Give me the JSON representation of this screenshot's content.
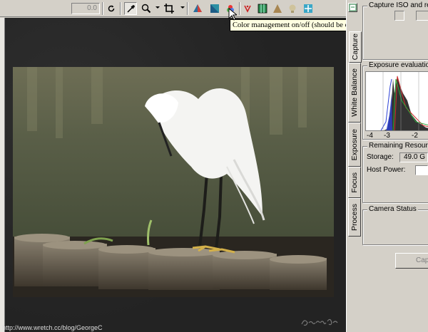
{
  "toolbar": {
    "value_field": "0.0",
    "tooltip": "Color management on/off (should be enabled in normal operation)"
  },
  "icons": [
    "rotate-icon",
    "eyedropper-icon",
    "zoom-icon",
    "crop-icon",
    "warning-icon",
    "overlay-icon",
    "color-management-icon",
    "focus-point-icon",
    "grid-icon",
    "triangle-icon",
    "bulb-icon",
    "fit-icon"
  ],
  "viewer": {
    "watermark": "http://www.wretch.cc/blog/GeorgeC",
    "signature": "GeorgeC"
  },
  "right_panel": {
    "tabs": [
      "Capture",
      "White Balance",
      "Exposure",
      "Focus",
      "Process"
    ],
    "capture_iso_title": "Capture ISO and res",
    "exposure_title": "Exposure evaluation",
    "histogram_ticks": [
      "-4",
      "-3",
      "-2"
    ],
    "remaining_title": "Remaining Resource",
    "storage_label": "Storage:",
    "storage_value": "49.0 G",
    "host_power_label": "Host Power:",
    "camera_status_title": "Camera Status",
    "capture_button": "Capt"
  },
  "colors": {
    "tooltip_bg": "#ffffe1",
    "panel_bg": "#d4d0c8",
    "viewer_bg": "#262626"
  }
}
